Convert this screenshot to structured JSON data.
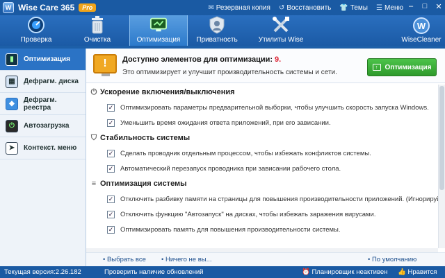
{
  "titlebar": {
    "app_name": "Wise Care 365",
    "badge": "Pro",
    "links": [
      {
        "icon": "backup-icon",
        "glyph": "✉",
        "label": "Резервная копия"
      },
      {
        "icon": "restore-icon",
        "glyph": "↺",
        "label": "Восстановить"
      },
      {
        "icon": "shirt-icon",
        "glyph": "👕",
        "label": "Темы"
      },
      {
        "icon": "menu-icon",
        "glyph": "☰",
        "label": "Меню"
      }
    ]
  },
  "toolbar": {
    "tabs": [
      {
        "icon": "speedometer-icon",
        "label": "Проверка"
      },
      {
        "icon": "trash-icon",
        "label": "Очистка"
      },
      {
        "icon": "optimize-icon",
        "label": "Оптимизация"
      },
      {
        "icon": "privacy-icon",
        "label": "Приватность"
      },
      {
        "icon": "tools-icon",
        "label": "Утилиты Wise"
      }
    ],
    "active_tab": "Оптимизация",
    "brand_letter": "W",
    "brand_label": "WiseCleaner"
  },
  "sidebar": {
    "items": [
      {
        "icon": "gauge-icon",
        "label": "Оптимизация",
        "active": true
      },
      {
        "icon": "disk-defrag-icon",
        "label": "Дефрагм. диска",
        "active": false
      },
      {
        "icon": "registry-defrag-icon",
        "label": "Дефрагм. реестра",
        "active": false
      },
      {
        "icon": "power-icon",
        "label": "Автозагрузка",
        "active": false
      },
      {
        "icon": "context-menu-icon",
        "label": "Контекст. меню",
        "active": false
      }
    ]
  },
  "banner": {
    "heading": "Доступно элементов для оптимизации:",
    "count": "9.",
    "subtext": "Это оптимизирует и улучшит производительность системы и сети.",
    "button_label": "Оптимизация"
  },
  "sections": [
    {
      "icon": "power-icon",
      "title": "Ускорение включения/выключения",
      "items": [
        {
          "checked": true,
          "label": "Оптимизировать параметры предварительной выборки, чтобы улучшить скорость запуска Windows."
        },
        {
          "checked": true,
          "label": "Уменьшить время ожидания ответа приложений, при его зависании."
        }
      ]
    },
    {
      "icon": "shield-icon",
      "title": "Стабильность системы",
      "items": [
        {
          "checked": true,
          "label": "Сделать проводник отдельным процессом, чтобы избежать конфликтов системы."
        },
        {
          "checked": true,
          "label": "Автоматический перезапуск проводника при зависании рабочего стола."
        }
      ]
    },
    {
      "icon": "system-icon",
      "title": "Оптимизация системы",
      "items": [
        {
          "checked": true,
          "label": "Отключить разбивку памяти на страницы для повышения производительности приложений. (Игнорируйте, если памяти <"
        },
        {
          "checked": true,
          "label": "Отключить функцию \"Автозапуск\" на дисках, чтобы избежать заражения вирусами."
        },
        {
          "checked": true,
          "label": "Оптимизировать память для повышения производительности системы."
        }
      ]
    }
  ],
  "bottom": {
    "select_all": "Выбрать все",
    "select_none": "Ничего не вы...",
    "default": "По умолчанию"
  },
  "status": {
    "version": "Текущая версия:2.26.182",
    "check_updates": "Проверить наличие обновлений",
    "scheduler": "Планировщик неактивен",
    "rate": "Нравится"
  }
}
